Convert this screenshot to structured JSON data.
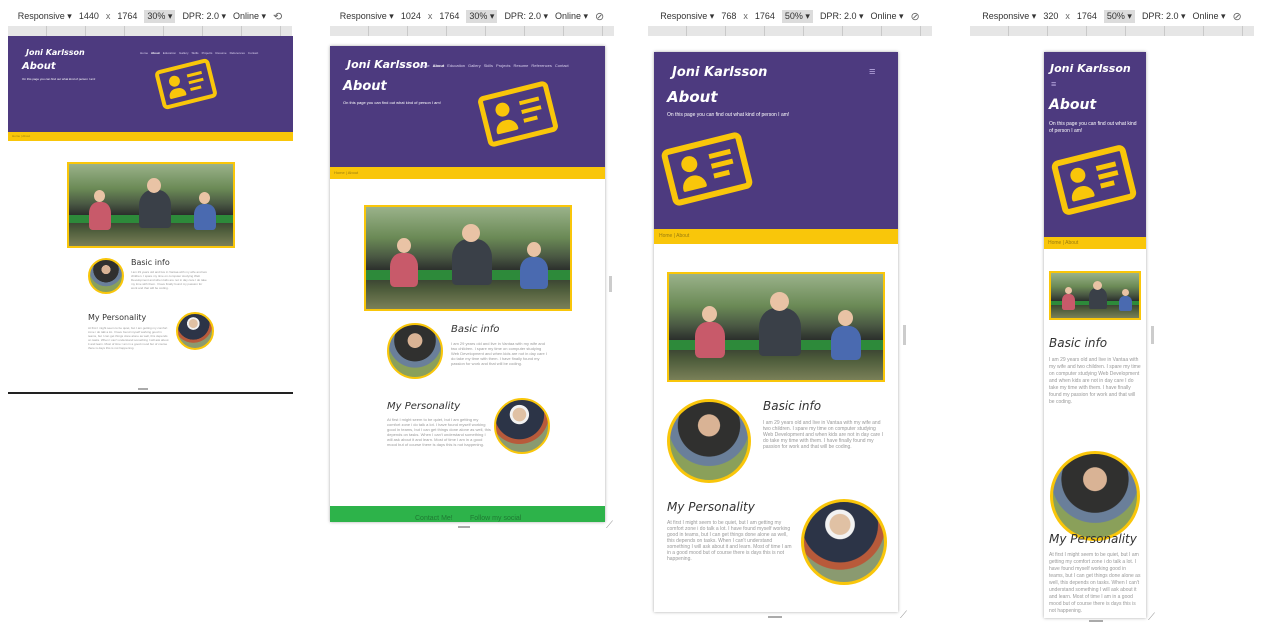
{
  "site": {
    "brand": "Joni Karlsson",
    "page_title": "About",
    "subtitle": "On this page you can find out what kind of person I am!",
    "nav": [
      "Home",
      "About",
      "Education",
      "Gallery",
      "Skills",
      "Projects",
      "Resume",
      "References",
      "Contact"
    ],
    "breadcrumb": "Home  |  About",
    "basic_heading": "Basic info",
    "basic_text": "I am 29 years old and live in Vantaa with my wife and two children. I spare my time on computer studying Web Development and when kids are not in day care I do take my time with them. I have finally found my passion for work and that will be coding.",
    "personality_heading": "My Personality",
    "personality_text": "At first I might seem to be quiet, but I am getting my comfort zone i do talk a lot. I have found myself working good in teams, but I can get things done alone as well, this depends on tasks. When I can't understand something I will ask about it and learn. Most of time I am in a good mood but of course there is days this is not happening.",
    "footer_links": [
      "Contact Me!",
      "Follow my social"
    ]
  },
  "panels": [
    {
      "mode": "Responsive",
      "width": "1440",
      "x": "x",
      "height": "1764",
      "zoom": "30%",
      "dpr": "DPR: 2.0",
      "network": "Online"
    },
    {
      "mode": "Responsive",
      "width": "1024",
      "x": "x",
      "height": "1764",
      "zoom": "30%",
      "dpr": "DPR: 2.0",
      "network": "Online"
    },
    {
      "mode": "Responsive",
      "width": "768",
      "x": "x",
      "height": "1764",
      "zoom": "50%",
      "dpr": "DPR: 2.0",
      "network": "Online"
    },
    {
      "mode": "Responsive",
      "width": "320",
      "x": "x",
      "height": "1764",
      "zoom": "50%",
      "dpr": "DPR: 2.0",
      "network": "Online"
    }
  ],
  "icons": {
    "dropdown": "chevron-down-icon",
    "rotate": "rotate-icon",
    "menu": "hamburger-menu-icon",
    "profile": "id-card-icon",
    "resize": "resize-corner-icon"
  },
  "colors": {
    "hero": "#4d3a7f",
    "accent": "#f9c60a",
    "footer": "#2db34a"
  }
}
